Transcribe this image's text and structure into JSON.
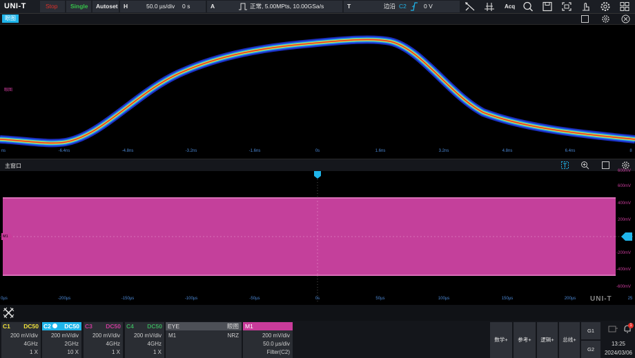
{
  "topbar": {
    "logo": "UNI-T",
    "run_state": "Stop",
    "single": "Single",
    "autoset": "Autoset",
    "h_label": "H",
    "timebase": "50.0 µs/div",
    "h_offset": "0 s",
    "a_label": "A",
    "acq_info": "正常, 5.00MPts, 10.00GSa/s",
    "t_label": "T",
    "trig_type": "边沿",
    "trig_source": "C2",
    "trig_level": "0 V",
    "acq_button": "Acq"
  },
  "eye_panel": {
    "tab": "眼图",
    "side_label": "眼图",
    "x_ticks": [
      "ns",
      "-6.4ns",
      "-4.8ns",
      "-3.2ns",
      "-1.6ns",
      "0s",
      "1.6ns",
      "3.2ns",
      "4.8ns",
      "6.4ns",
      "8"
    ]
  },
  "main_panel": {
    "title": "主窗口",
    "marker_m1": "M1",
    "y_ticks": [
      "600mV",
      "600mV",
      "400mV",
      "200mV",
      "-200mV",
      "-400mV",
      "-600mV"
    ],
    "x_ticks": [
      "0µs",
      "-200µs",
      "-150µs",
      "-100µs",
      "-50µs",
      "0s",
      "50µs",
      "100µs",
      "150µs",
      "200µs",
      "25"
    ],
    "watermark": "UNI-T"
  },
  "channels": [
    {
      "name": "C1",
      "coupling": "DC50",
      "scale": "200 mV/div",
      "bw": "4GHz",
      "probe": "1 X",
      "color": "#f2e33b"
    },
    {
      "name": "C2",
      "coupling": "DC50",
      "scale": "200 mV/div",
      "bw": "2GHz",
      "probe": "10 X",
      "color": "#1fb5ea"
    },
    {
      "name": "C3",
      "coupling": "DC50",
      "scale": "200 mV/div",
      "bw": "4GHz",
      "probe": "1 X",
      "color": "#c93b9a"
    },
    {
      "name": "C4",
      "coupling": "DC50",
      "scale": "200 mV/div",
      "bw": "4GHz",
      "probe": "1 X",
      "color": "#3aa95b"
    }
  ],
  "eye_box": {
    "title": "EYE",
    "right": "眼图",
    "source": "M1",
    "mode": "NRZ"
  },
  "m1_box": {
    "title": "M1",
    "scale": "200 mV/div",
    "timebase": "50.0 µs/div",
    "source": "Filter(C2)"
  },
  "right_buttons": {
    "math": "数学+",
    "ref": "参考+",
    "logic": "逻辑+",
    "bus": "总线+",
    "g1": "G1",
    "g2": "G2"
  },
  "clock": {
    "time": "13:25",
    "date": "2024/03/06",
    "notify_count": "1"
  },
  "colors": {
    "accent": "#1fb5ea",
    "math": "#c93b9a",
    "stop": "#e0302a",
    "single": "#36c24a"
  }
}
